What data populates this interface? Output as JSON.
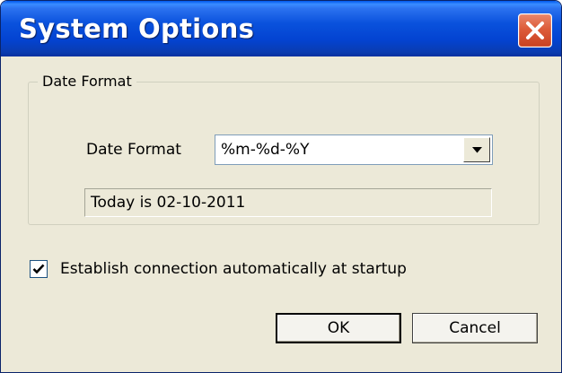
{
  "window": {
    "title": "System Options",
    "close_icon": "close-icon",
    "accent_color": "#0a52dd"
  },
  "date_format_group": {
    "legend": "Date Format",
    "field_label": "Date Format",
    "selected_value": "%m-%d-%Y",
    "dropdown_icon": "chevron-down-icon",
    "preview_text": "Today is 02-10-2011"
  },
  "auto_connect": {
    "label": "Establish connection automatically at startup",
    "checked": true
  },
  "buttons": {
    "ok_label": "OK",
    "cancel_label": "Cancel"
  }
}
